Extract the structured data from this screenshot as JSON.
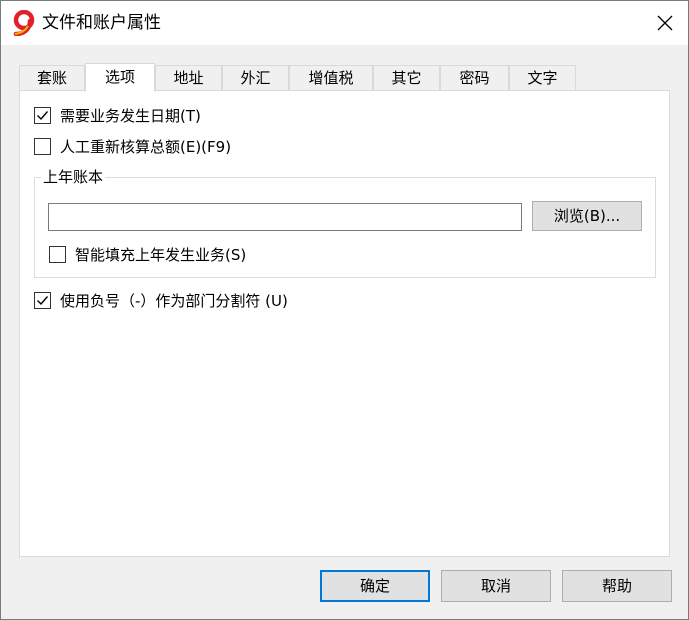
{
  "window": {
    "title": "文件和账户属性",
    "accent_color": "#0078d7",
    "app_icon": "app-logo-icon",
    "close_icon": "close-icon"
  },
  "tabs": [
    {
      "label": "套账",
      "active": false
    },
    {
      "label": "选项",
      "active": true
    },
    {
      "label": "地址",
      "active": false
    },
    {
      "label": "外汇",
      "active": false
    },
    {
      "label": "增值税",
      "active": false
    },
    {
      "label": "其它",
      "active": false
    },
    {
      "label": "密码",
      "active": false
    },
    {
      "label": "文字",
      "active": false
    }
  ],
  "options": {
    "require_date": {
      "label": "需要业务发生日期(T)",
      "checked": true
    },
    "recalc_total": {
      "label": "人工重新核算总额(E)(F9)",
      "checked": false
    },
    "prev_year": {
      "legend": "上年账本",
      "path_value": "",
      "browse_label": "浏览(B)...",
      "smart_fill": {
        "label": "智能填充上年发生业务(S)",
        "checked": false
      }
    },
    "dept_separator": {
      "label": "使用负号（-）作为部门分割符 (U)",
      "checked": true
    }
  },
  "footer": {
    "ok_label": "确定",
    "cancel_label": "取消",
    "help_label": "帮助"
  }
}
